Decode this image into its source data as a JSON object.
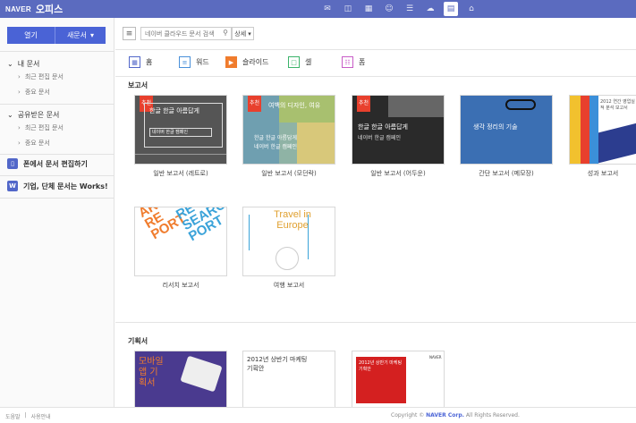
{
  "header": {
    "brand": "NAVER",
    "product": "오피스",
    "apps": [
      {
        "name": "mail-app-icon",
        "glyph": "✉"
      },
      {
        "name": "drive-app-icon",
        "glyph": "☁"
      },
      {
        "name": "calendar-app-icon",
        "glyph": "▦"
      },
      {
        "name": "contacts-app-icon",
        "glyph": "☺"
      },
      {
        "name": "memo-app-icon",
        "glyph": "✎"
      },
      {
        "name": "cloud-app-icon",
        "glyph": "☁"
      },
      {
        "name": "office-app-icon",
        "glyph": "▤"
      },
      {
        "name": "home-app-icon",
        "glyph": "⌂"
      }
    ]
  },
  "sidebar": {
    "open_label": "열기",
    "new_label": "새문서",
    "my_docs": "내 문서",
    "my_recent": "최근 편집 문서",
    "my_important": "중요 문서",
    "shared_docs": "공유받은 문서",
    "shared_recent": "최근 편집 문서",
    "shared_important": "중요 문서",
    "promo_phone": "폰에서 문서 편집하기",
    "promo_works": "기업, 단체 문서는 Works!"
  },
  "toolbar": {
    "search_placeholder": "네이버 클라우드 문서 검색",
    "detail_label": "상세"
  },
  "filters": {
    "home": "홈",
    "word": "워드",
    "slide": "슬라이드",
    "cell": "셀",
    "form": "폼"
  },
  "sections": {
    "report": "보고서",
    "plan": "기획서"
  },
  "templates": {
    "badge": "추천",
    "t1_title": "한글 한글 아름답게",
    "t1_sub": "네이버 한글 캠페인",
    "t1_cap": "일반 보고서 (레트로)",
    "t2_title": "여백의 디자인, 여유",
    "t2_sub": "한글 한글 아름답게",
    "t2_sub2": "네이버 한글 캠페인",
    "t2_cap": "일반 보고서 (모던락)",
    "t3_title": "한글 한글 아름답게",
    "t3_sub": "네이버 한글 캠페인",
    "t3_cap": "일반 보고서 (어두운)",
    "t4_title": "생각 정리의 기술",
    "t4_cap": "간단 보고서 (메모장)",
    "t5_title": "2012 연간 영업실적 분석 보고서",
    "t5_cap": "성과 보고서",
    "t6_cap": "리서치 보고서",
    "t7_title": "Travel in Europe",
    "t7_cap": "여행 보고서",
    "t8_title": "모바일 앱 기획서",
    "t9_title": "2012년 상반기 마케팅 기획안",
    "t10_title": "2012년 상반기 마케팅 기획안",
    "t10_brand": "NAVER"
  },
  "footer": {
    "left1": "도움말",
    "left2": "사용안내",
    "copyright_pre": "Copyright ©",
    "copyright_brand": "NAVER Corp.",
    "copyright_post": "All Rights Reserved."
  }
}
